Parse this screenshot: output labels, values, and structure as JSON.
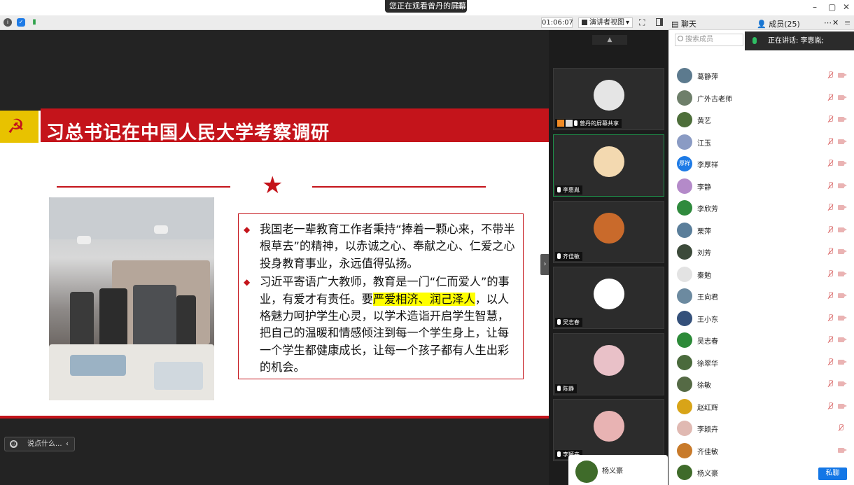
{
  "window": {
    "share_banner": "您正在观看曾丹的屏幕",
    "minimize": "–",
    "restore": "▢",
    "close": "✕"
  },
  "toolbar": {
    "timer": "01:06:07",
    "presenter_view": "演讲者视图",
    "dropdown_caret": "▾"
  },
  "slide": {
    "title": "习总书记在中国人民大学考察调研",
    "paragraph1": "我国老一辈教育工作者秉持“捧着一颗心来，不带半根草去”的精神，以赤诚之心、奉献之心、仁爱之心投身教育事业，永远值得弘扬。",
    "paragraph2_before": "习近平寄语广大教师，教育是一门“仁而爱人”的事业，有爱才有责任。要",
    "paragraph2_highlight": "严爱相济、润己泽人",
    "paragraph2_after": "，以人格魅力呵护学生心灵，以学术造诣开启学生智慧，把自己的温暖和情感倾注到每一个学生身上，让每一个学生都健康成长，让每一个孩子都有人生出彩的机会。"
  },
  "chat_input": {
    "placeholder": "说点什么..."
  },
  "video_tiles": [
    {
      "label": "曾丹的屏幕共享",
      "avatar_color": "#e5e5e5",
      "active": false
    },
    {
      "label": "李惠胤",
      "avatar_color": "#f3d9b0",
      "active": true
    },
    {
      "label": "齐佳敏",
      "avatar_color": "#c96a2b",
      "active": false
    },
    {
      "label": "吴志春",
      "avatar_color": "#ffffff",
      "active": false
    },
    {
      "label": "陈静",
      "avatar_color": "#e9c1c8",
      "active": false
    },
    {
      "label": "李颖卉",
      "avatar_color": "#e8b3b3",
      "active": false
    }
  ],
  "floating_card": {
    "name": "杨义豪"
  },
  "panel": {
    "chat_tab": "聊天",
    "members_tab": "成员(25)",
    "more": "⋯",
    "close": "✕",
    "menu": "≡",
    "search_placeholder": "搜索成员",
    "speaking": "正在讲话: 李惠胤;",
    "private_chat": "私聊",
    "members": [
      {
        "name": "葛静萍",
        "color": "#5c7a8e",
        "initials": ""
      },
      {
        "name": "广外古老师",
        "color": "#6e7f6a",
        "initials": ""
      },
      {
        "name": "黄艺",
        "color": "#4d6e3a",
        "initials": ""
      },
      {
        "name": "江玉",
        "color": "#8a9bc4",
        "initials": ""
      },
      {
        "name": "李厚祥",
        "color": "#1e7be6",
        "initials": "厚祥"
      },
      {
        "name": "李静",
        "color": "#b48ac9",
        "initials": ""
      },
      {
        "name": "李欣芳",
        "color": "#2f8a3d",
        "initials": ""
      },
      {
        "name": "栗萍",
        "color": "#5a7e9a",
        "initials": ""
      },
      {
        "name": "刘芳",
        "color": "#3c4a3a",
        "initials": ""
      },
      {
        "name": "秦勉",
        "color": "#e3e3e3",
        "initials": ""
      },
      {
        "name": "王向君",
        "color": "#6c8aa0",
        "initials": ""
      },
      {
        "name": "王小东",
        "color": "#34507a",
        "initials": ""
      },
      {
        "name": "吴志春",
        "color": "#2c8a38",
        "initials": ""
      },
      {
        "name": "徐翠华",
        "color": "#4a6a3c",
        "initials": ""
      },
      {
        "name": "徐敏",
        "color": "#556a45",
        "initials": ""
      },
      {
        "name": "赵红辉",
        "color": "#d8a418",
        "initials": ""
      },
      {
        "name": "李颖卉",
        "color": "#e0b9b2",
        "initials": ""
      },
      {
        "name": "齐佳敏",
        "color": "#c87a2a",
        "initials": ""
      },
      {
        "name": "杨义豪",
        "color": "#3f6b2a",
        "initials": ""
      }
    ]
  }
}
